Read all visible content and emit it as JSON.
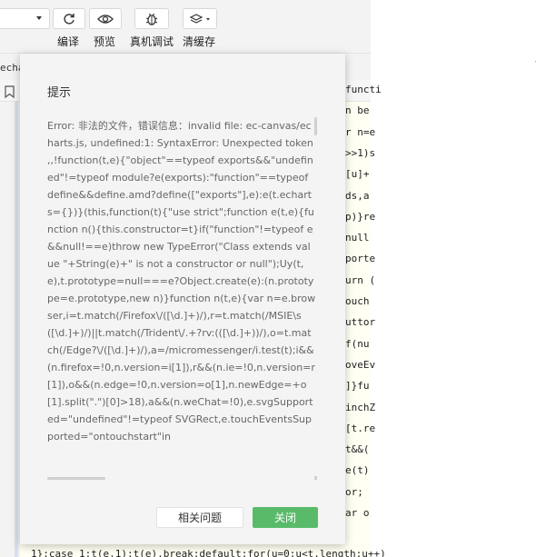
{
  "toolbar": {
    "compile_label": "编译",
    "preview_label": "预览",
    "remote_debug_label": "真机调试",
    "clear_cache_label": "清缓存"
  },
  "tab": {
    "text": "echa"
  },
  "code_fragments": [
    "functi",
    "n be",
    "r n=e",
    ">>1)s",
    "[u]+",
    "ds,a",
    "p)}re",
    "null",
    "porte",
    "urn (",
    "ouch",
    "uttor",
    "f(nu",
    "oveEv",
    "]}fu",
    "inchZ",
    "[t.re",
    "t&&(",
    "e(t)",
    "or;",
    "ar o"
  ],
  "code_bottom": "1};case 1:t(e,1);t(e).break;default:for(u=0;u<t.length;u++)",
  "dialog": {
    "title": "提示",
    "message": "Error: 非法的文件，错误信息：invalid file: ec-canvas/echarts.js, undefined:1: SyntaxError: Unexpected token ,,!function(t,e){\"object\"==typeof exports&&\"undefined\"!=typeof module?e(exports):\"function\"==typeof define&&define.amd?define([\"exports\"],e):e(t.echarts={})}(this,function(t){\"use strict\";function e(t,e){function n(){this.constructor=t}if(\"function\"!=typeof e&&null!==e)throw new TypeError(\"Class extends value \"+String(e)+\" is not a constructor or null\");Uy(t,e),t.prototype=null===e?Object.create(e):(n.prototype=e.prototype,new n)}function n(t,e){var n=e.browser,i=t.match(/Firefox\\/([\\d.]+)/),r=t.match(/MSIE\\s([\\d.]+)/)||t.match(/Trident\\/.+?rv:(([\\d.]+))/),o=t.match(/Edge?\\/([\\d.]+)/),a=/micromessenger/i.test(t);i&&(n.firefox=!0,n.version=i[1]),r&&(n.ie=!0,n.version=r[1]),o&&(n.edge=!0,n.version=o[1],n.newEdge=+o[1].split(\".\")[0]>18),a&&(n.weChat=!0),e.svgSupported=\"undefined\"!=typeof SVGRect,e.touchEventsSupported=\"ontouchstart\"in",
    "related_button": "相关问题",
    "close_button": "关闭"
  },
  "colors": {
    "accent_green": "#59bb6a",
    "code_background": "#fffff3"
  }
}
